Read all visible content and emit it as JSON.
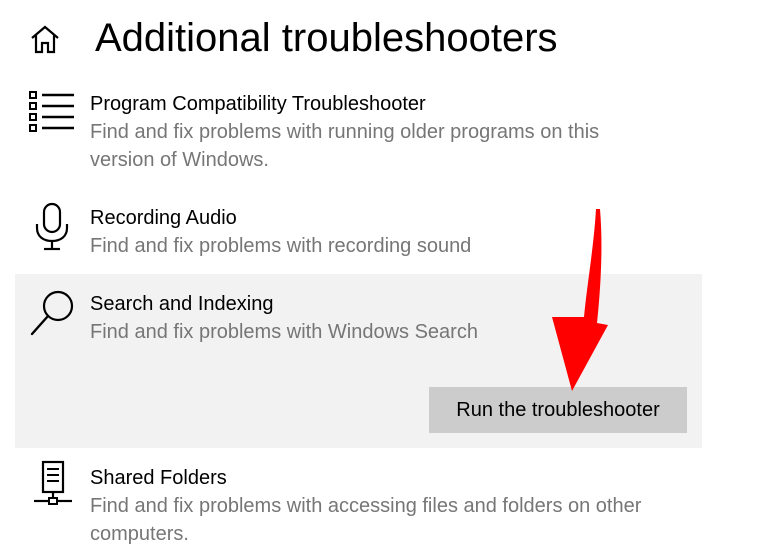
{
  "header": {
    "title": "Additional troubleshooters",
    "home_icon": "home-icon"
  },
  "troubleshooters": [
    {
      "name": "Program Compatibility Troubleshooter",
      "description": "Find and fix problems with running older programs on this version of Windows.",
      "icon": "list-icon"
    },
    {
      "name": "Recording Audio",
      "description": "Find and fix problems with recording sound",
      "icon": "microphone-icon"
    },
    {
      "name": "Search and Indexing",
      "description": "Find and fix problems with Windows Search",
      "icon": "search-icon",
      "selected": true,
      "button_label": "Run the troubleshooter"
    },
    {
      "name": "Shared Folders",
      "description": "Find and fix problems with accessing files and folders on other computers.",
      "icon": "network-computer-icon"
    }
  ],
  "annotation": {
    "arrow_color": "#ff0000",
    "arrow_icon": "red-arrow"
  },
  "colors": {
    "selected_background": "#f2f2f2",
    "description_text": "#767676",
    "button_background": "#cccccc"
  }
}
